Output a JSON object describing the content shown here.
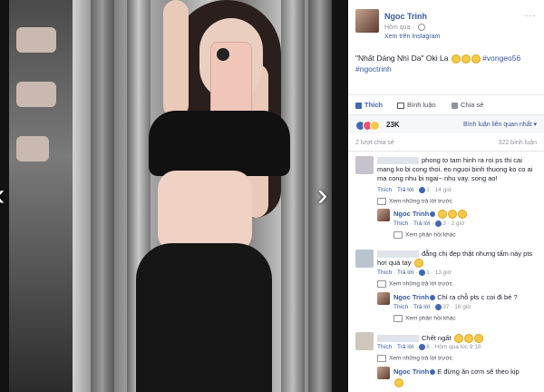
{
  "post": {
    "author": "Ngoc Trinh",
    "time": "Hôm qua · ",
    "via": "Xem trên Instagram",
    "more_label": "···",
    "caption_text": "\"Nhất Dáng Nhì Da\" Oki La ",
    "hashtags": [
      "#vongeo56",
      "#ngoctrinh"
    ]
  },
  "actions": {
    "like": "Thích",
    "comment": "Bình luận",
    "share": "Chia sẻ"
  },
  "reactions": {
    "count": "23K",
    "sort_label": "Bình luận liên quan nhất ▾",
    "colors": {
      "like": "#4267b2",
      "love": "#f25268",
      "haha": "#f7c948"
    }
  },
  "stats": {
    "shares": "2 lượt chia sẻ",
    "comments": "322 bình luận"
  },
  "comments": [
    {
      "text": "phong to tam hinh ra roi ps thi cai mang ko bi cong thoi. eo nguoi binh thuong ko co ai ma cong nhu bi ngai~ nhu vay. song ao!",
      "like": "Thích",
      "reply": "Trả lời",
      "likes": "1",
      "time": "14 giờ",
      "view_replies": "Xem những trả lời trước",
      "reply_obj": {
        "author": "Ngoc Trinh",
        "text": "",
        "like": "Thích",
        "reply": "Trả lời",
        "likes": "3",
        "time": "2 giờ"
      },
      "more_replies": "Xem phản hồi khác"
    },
    {
      "text": "đẳng chị đẹp thật nhưng tấm này pts hơi quá tay",
      "like": "Thích",
      "reply": "Trả lời",
      "likes": "1",
      "time": "13 giờ",
      "view_replies": "Xem những trả lời trước",
      "reply_obj": {
        "author": "Ngoc Trinh",
        "text": "Chỉ ra chỗ pts c coi đi bé ?",
        "like": "Thích",
        "reply": "Trả lời",
        "likes": "37",
        "time": "16 giờ"
      },
      "more_replies": "Xem phản hồi khác"
    },
    {
      "text": "Chết ngất",
      "like": "Thích",
      "reply": "Trả lời",
      "likes": "6",
      "time": "Hôm qua lúc 9:18",
      "view_replies": "Xem những trả lời trước",
      "reply_obj": {
        "author": "Ngoc Trinh",
        "text": "E đừng ăn cơm sẽ theo kịp",
        "like": "Thích",
        "reply": "Trả lời",
        "likes": "",
        "time": ""
      }
    }
  ],
  "nav": {
    "left": "‹",
    "right": "›"
  }
}
